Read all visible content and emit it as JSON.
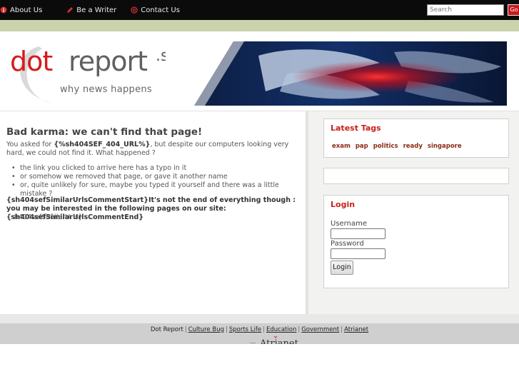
{
  "topnav": {
    "items": [
      {
        "label": "About Us",
        "icon": "about-icon"
      },
      {
        "label": "Be a Writer",
        "icon": "writer-icon"
      },
      {
        "label": "Contact Us",
        "icon": "contact-icon"
      }
    ],
    "search_placeholder": "Search",
    "search_go": "Go"
  },
  "header": {
    "logo_dot": "dot",
    "logo_report": "report",
    "logo_sg": ".sg",
    "tagline": "why news happens"
  },
  "content": {
    "title": "Bad karma: we can't find that page!",
    "intro_before": "You asked for ",
    "intro_bold": "{%sh404SEF_404_URL%}",
    "intro_after": ", but despite our computers looking very hard, we could not find it. What happened ?",
    "reasons": [
      "the link you clicked to arrive here has a typo in it",
      "or somehow we removed that page, or gave it another name",
      "or, quite unlikely for sure, maybe you typed it yourself and there was a little mistake ?"
    ],
    "note": "{sh404sefSimilarUrlsCommentStart}It's not the end of everything though : you may be interested in the following pages on our site:{sh404sefSimilarUrlsCommentEnd}",
    "similar": "{sh404sefSimilarUrls}"
  },
  "sidebar": {
    "tags_title": "Latest Tags",
    "tags": [
      "exam",
      "pap",
      "politics",
      "ready",
      "singapore"
    ],
    "login_title": "Login",
    "username_label": "Username",
    "password_label": "Password",
    "login_button": "Login"
  },
  "footer": {
    "site": "Dot Report",
    "links": [
      "Culture Bug",
      "Sports Life",
      "Education",
      "Government",
      "Atrianet"
    ]
  },
  "colors": {
    "accent": "#c8211b",
    "topbar": "#0b0b0b",
    "greenband": "#c9d3ac",
    "footer": "#cfcfcf"
  }
}
